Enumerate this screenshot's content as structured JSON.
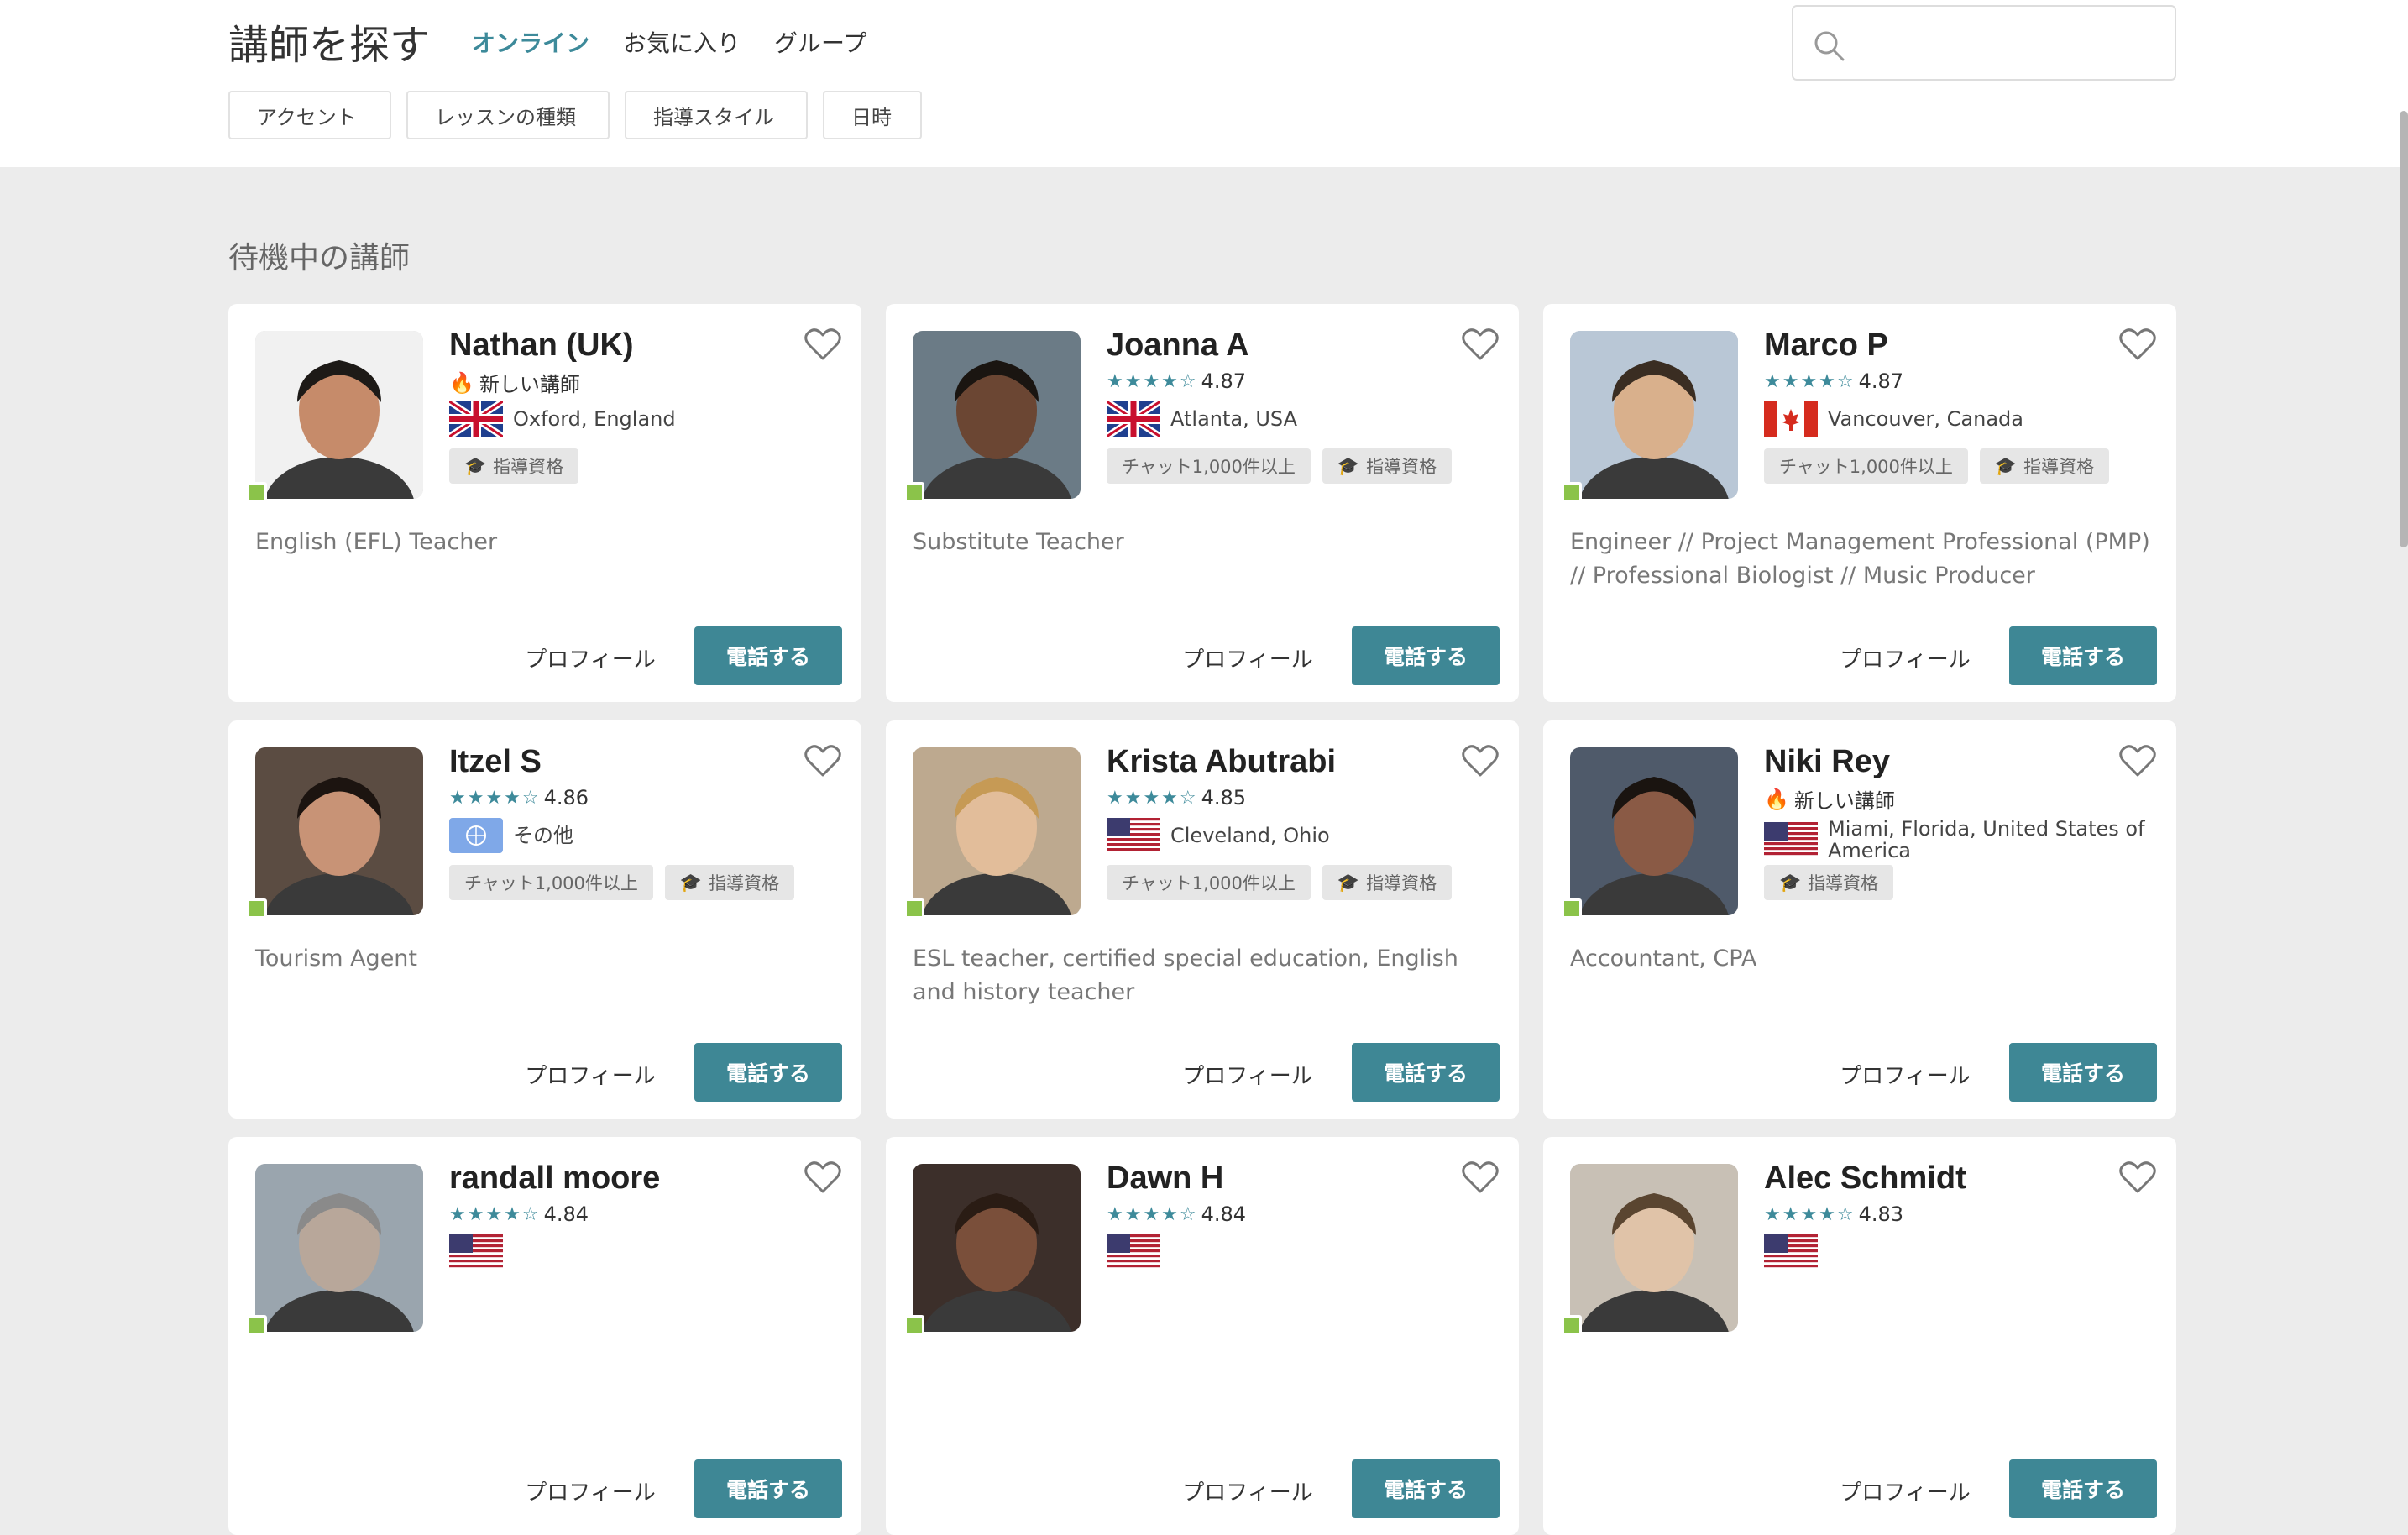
{
  "header": {
    "title": "講師を探す",
    "tabs": [
      {
        "label": "オンライン",
        "active": true
      },
      {
        "label": "お気に入り",
        "active": false
      },
      {
        "label": "グループ",
        "active": false
      }
    ],
    "search_placeholder": ""
  },
  "filters": [
    "アクセント",
    "レッスンの種類",
    "指導スタイル",
    "日時"
  ],
  "section_title": "待機中の講師",
  "colors": {
    "accent": "#3d8a9a",
    "button": "#3e8795",
    "online": "#8bc34a"
  },
  "common": {
    "profile_label": "プロフィール",
    "call_label": "電話する",
    "new_teacher": "新しい講師"
  },
  "tutors": [
    {
      "name": "Nathan (UK)",
      "is_new": true,
      "rating": "",
      "location": "Oxford, England",
      "flag": "uk",
      "tags": [
        "指導資格"
      ],
      "description": "English (EFL) Teacher"
    },
    {
      "name": "Joanna A",
      "is_new": false,
      "rating": "4.87",
      "location": "Atlanta, USA",
      "flag": "uk",
      "tags": [
        "チャット1,000件以上",
        "指導資格"
      ],
      "description": "Substitute Teacher"
    },
    {
      "name": "Marco P",
      "is_new": false,
      "rating": "4.87",
      "location": "Vancouver, Canada",
      "flag": "ca",
      "tags": [
        "チャット1,000件以上",
        "指導資格"
      ],
      "description": "Engineer // Project Management Professional (PMP) // Professional Biologist // Music Producer"
    },
    {
      "name": "Itzel S",
      "is_new": false,
      "rating": "4.86",
      "location": "その他",
      "flag": "un",
      "tags": [
        "チャット1,000件以上",
        "指導資格"
      ],
      "description": "Tourism Agent"
    },
    {
      "name": "Krista Abutrabi",
      "is_new": false,
      "rating": "4.85",
      "location": "Cleveland, Ohio",
      "flag": "us",
      "tags": [
        "チャット1,000件以上",
        "指導資格"
      ],
      "description": "ESL teacher, certified special education, English and history teacher"
    },
    {
      "name": "Niki Rey",
      "is_new": true,
      "rating": "",
      "location": "Miami, Florida, United States of America",
      "flag": "us",
      "tags": [
        "指導資格"
      ],
      "description": "Accountant, CPA"
    },
    {
      "name": "randall moore",
      "is_new": false,
      "rating": "4.84",
      "location": "",
      "flag": "us",
      "tags": [],
      "description": ""
    },
    {
      "name": "Dawn H",
      "is_new": false,
      "rating": "4.84",
      "location": "",
      "flag": "us",
      "tags": [],
      "description": ""
    },
    {
      "name": "Alec Schmidt",
      "is_new": false,
      "rating": "4.83",
      "location": "",
      "flag": "us",
      "tags": [],
      "description": ""
    }
  ]
}
